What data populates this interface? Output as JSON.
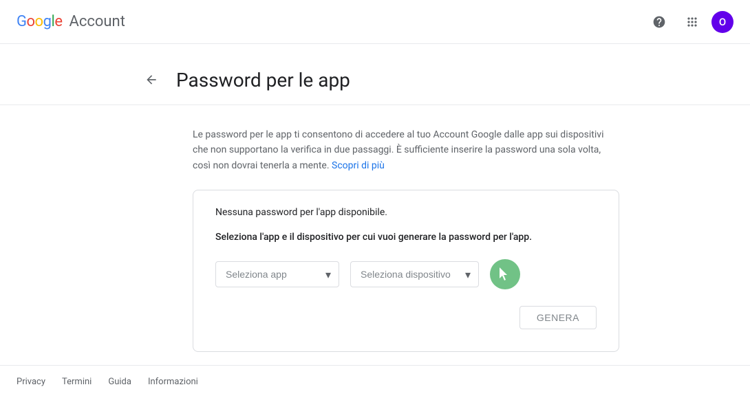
{
  "header": {
    "brand": "Google",
    "brand_letters": [
      "G",
      "o",
      "o",
      "g",
      "l",
      "e"
    ],
    "title": "Account",
    "help_label": "Guida",
    "apps_label": "App Google",
    "avatar_letter": "O"
  },
  "page": {
    "back_label": "←",
    "title": "Password per le app",
    "description_text": "Le password per le app ti consentono di accedere al tuo Account Google dalle app sui dispositivi che non supportano la verifica in due passaggi. È sufficiente inserire la password una sola volta, così non dovrai tenerla a mente.",
    "learn_more_label": "Scopri di più",
    "no_passwords_msg": "Nessuna password per l'app disponibile.",
    "instruction": "Seleziona l'app e il dispositivo per cui vuoi generare la password per l'app.",
    "select_app_placeholder": "Seleziona app",
    "select_device_placeholder": "Seleziona dispositivo",
    "genera_label": "GENERA"
  },
  "footer": {
    "links": [
      "Privacy",
      "Termini",
      "Guida",
      "Informazioni"
    ]
  }
}
